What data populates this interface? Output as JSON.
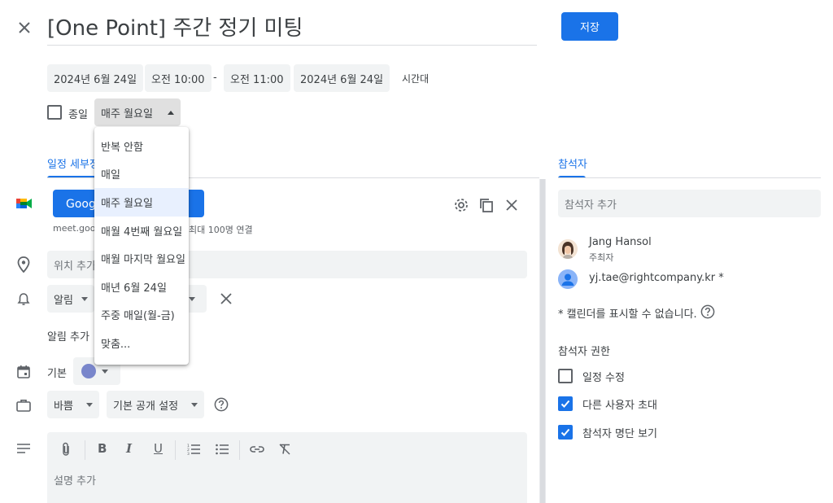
{
  "header": {
    "close_label": "×",
    "title": "[One Point] 주간 정기 미팅",
    "save_label": "저장"
  },
  "datetime": {
    "start_date": "2024년 6월 24일",
    "start_time": "오전 10:00",
    "separator": "-",
    "end_time": "오전 11:00",
    "end_date": "2024년 6월 24일",
    "timezone_label": "시간대"
  },
  "all_day": {
    "label": "종일",
    "checked": false
  },
  "recurrence": {
    "selected": "매주 월요일",
    "options": [
      "반복 안함",
      "매일",
      "매주 월요일",
      "매월 4번째 월요일",
      "매월 마지막 월요일",
      "매년 6월 24일",
      "주중 매일(월-금)",
      "맞춤..."
    ]
  },
  "tabs": {
    "details": "일정 세부정보",
    "guests": "참석자"
  },
  "meet": {
    "button_label": "Google Meet로 참여",
    "link_text": "meet.google.com/…",
    "capacity_text": "최대 100명 연결"
  },
  "location": {
    "placeholder": "위치 추가"
  },
  "notification": {
    "type": "알림",
    "add_label": "알림 추가"
  },
  "calendar": {
    "label": "기본",
    "color": "#7986cb"
  },
  "availability": {
    "status": "바쁨",
    "visibility": "기본 공개 설정"
  },
  "description": {
    "placeholder": "설명 추가"
  },
  "guests": {
    "add_placeholder": "참석자 추가",
    "list": [
      {
        "name": "Jang Hansol",
        "role": "주최자"
      },
      {
        "name": "yj.tae@rightcompany.kr *",
        "role": ""
      }
    ],
    "calendar_notice": "* 캘린더를 표시할 수 없습니다.",
    "permissions_title": "참석자 권한",
    "permissions": [
      {
        "label": "일정 수정",
        "checked": false
      },
      {
        "label": "다른 사용자 초대",
        "checked": true
      },
      {
        "label": "참석자 명단 보기",
        "checked": true
      }
    ]
  },
  "colors": {
    "accent": "#1a73e8",
    "chip_bg": "#f1f3f4"
  }
}
